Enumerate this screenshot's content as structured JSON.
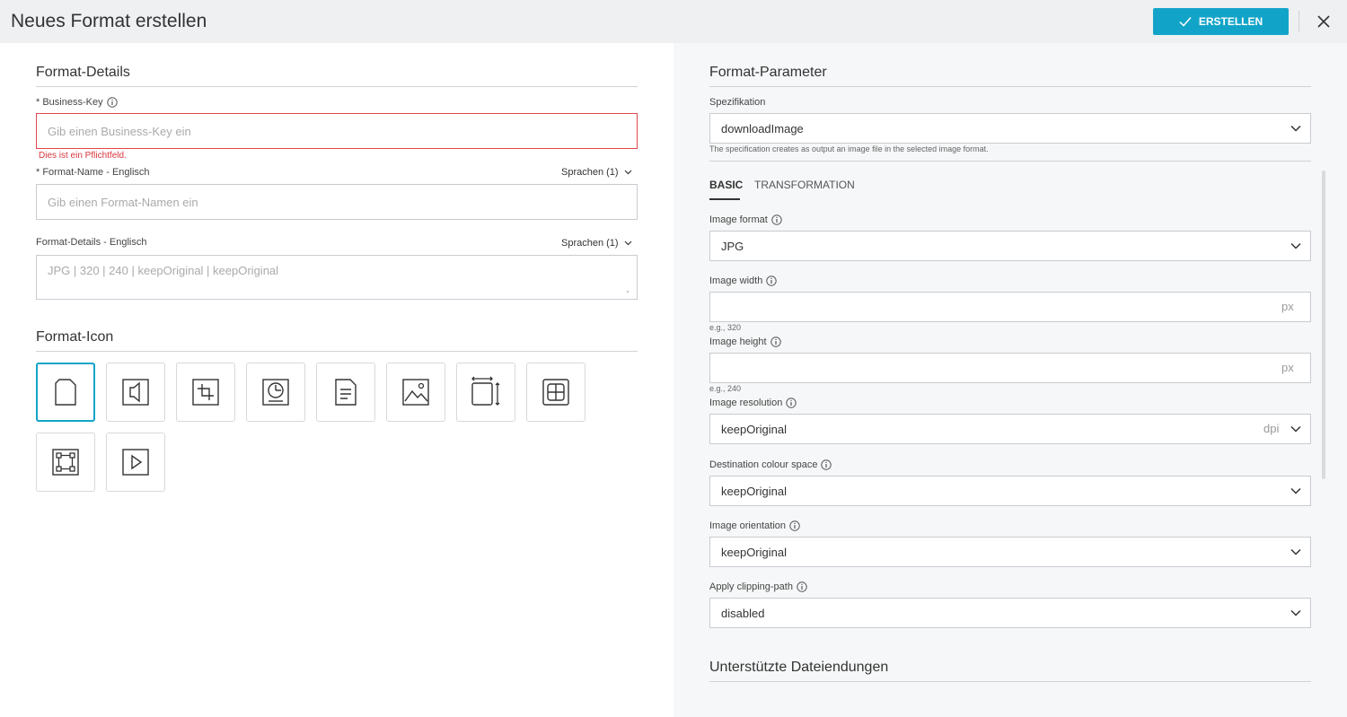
{
  "header": {
    "title": "Neues Format erstellen",
    "create_label": "ERSTELLEN"
  },
  "left": {
    "details_title": "Format-Details",
    "business_key": {
      "label": "* Business-Key",
      "placeholder": "Gib einen Business-Key ein",
      "error": "Dies ist ein Pflichtfeld."
    },
    "format_name": {
      "label": "* Format-Name - Englisch",
      "languages": "Sprachen (1)",
      "placeholder": "Gib einen Format-Namen ein"
    },
    "format_details": {
      "label": "Format-Details - Englisch",
      "languages": "Sprachen (1)",
      "placeholder": "JPG | 320 | 240 | keepOriginal | keepOriginal"
    },
    "icon_title": "Format-Icon",
    "icons": [
      "document-icon",
      "audio-icon",
      "crop-icon",
      "disc-icon",
      "text-document-icon",
      "image-icon",
      "resize-icon",
      "grid-icon",
      "transform-icon",
      "video-play-icon"
    ]
  },
  "right": {
    "params_title": "Format-Parameter",
    "spec": {
      "label": "Spezifikation",
      "value": "downloadImage",
      "hint": "The specification creates as output an image file in the selected image format."
    },
    "tabs": [
      {
        "label": "BASIC",
        "active": true
      },
      {
        "label": "TRANSFORMATION",
        "active": false
      }
    ],
    "image_format": {
      "label": "Image format",
      "value": "JPG"
    },
    "image_width": {
      "label": "Image width",
      "unit": "px",
      "hint": "e.g., 320"
    },
    "image_height": {
      "label": "Image height",
      "unit": "px",
      "hint": "e.g., 240"
    },
    "image_resolution": {
      "label": "Image resolution",
      "value": "keepOriginal",
      "unit": "dpi"
    },
    "colour_space": {
      "label": "Destination colour space",
      "value": "keepOriginal"
    },
    "orientation": {
      "label": "Image orientation",
      "value": "keepOriginal"
    },
    "clipping": {
      "label": "Apply clipping-path",
      "value": "disabled"
    },
    "extensions_title": "Unterstützte Dateiendungen"
  },
  "colors": {
    "accent": "#12a4c8",
    "error": "#d9363e",
    "header_bg": "#eef0f2",
    "right_bg": "#f6f7f8"
  }
}
